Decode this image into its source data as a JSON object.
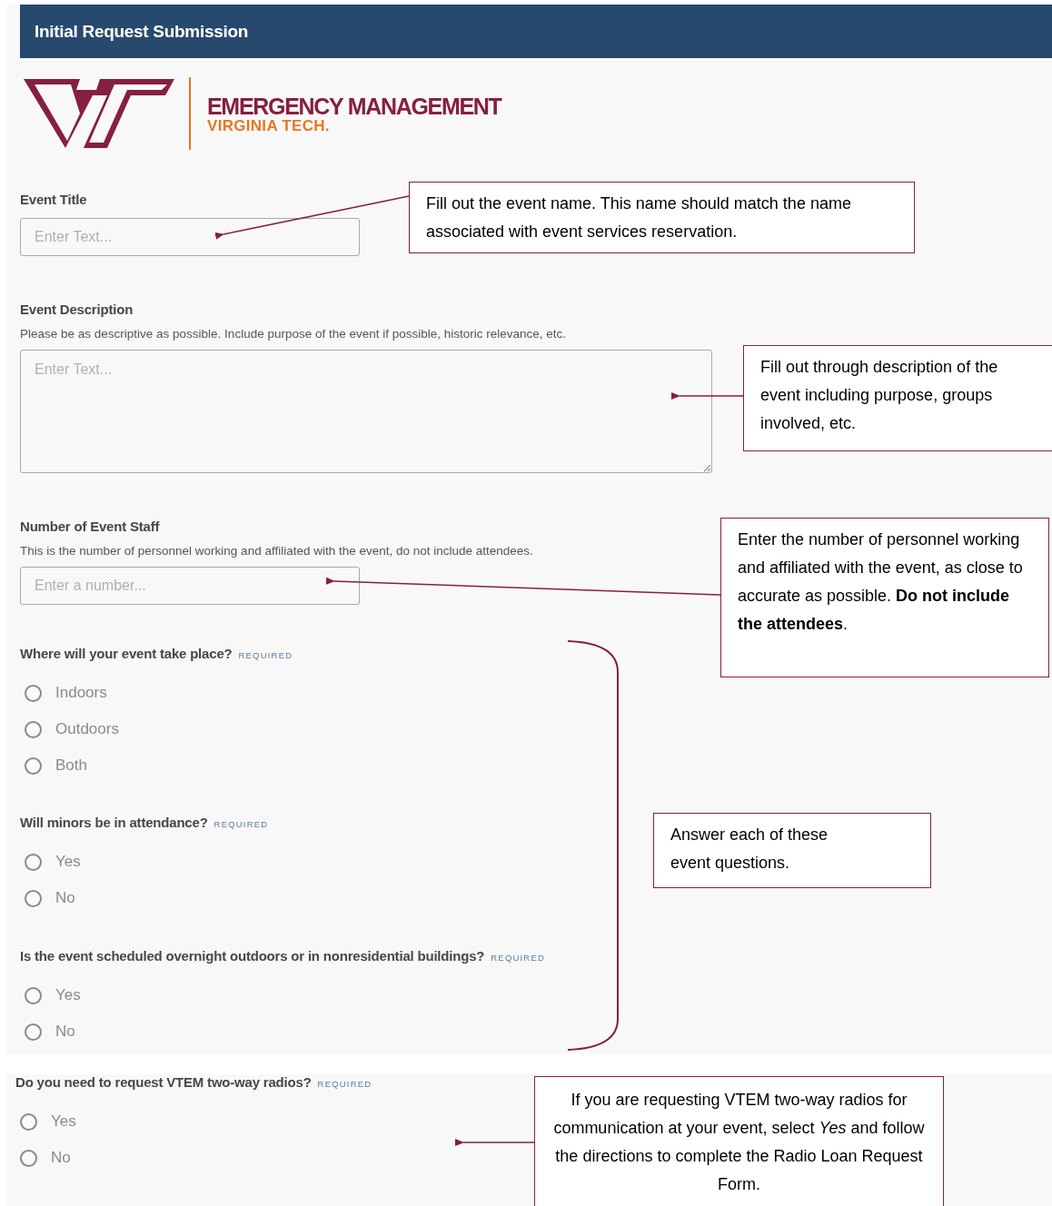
{
  "header": {
    "title": "Initial Request Submission"
  },
  "logo": {
    "title": "EMERGENCY MANAGEMENT",
    "subtitle": "VIRGINIA TECH."
  },
  "form": {
    "fields": [
      {
        "kind": "text",
        "label": "Event Title",
        "placeholder": "Enter Text..."
      },
      {
        "kind": "textarea",
        "label": "Event Description",
        "help": "Please be as descriptive as possible. Include purpose of the event if possible, historic relevance, etc.",
        "placeholder": "Enter Text..."
      },
      {
        "kind": "number",
        "label": "Number of Event Staff",
        "help": "This is the number of personnel working and affiliated with the event, do not include attendees.",
        "placeholder": "Enter a number..."
      }
    ],
    "questions": [
      {
        "label": "Where will your event take place?",
        "badge": "REQUIRED",
        "options": [
          {
            "label": "Indoors",
            "selected": false
          },
          {
            "label": "Outdoors",
            "selected": false
          },
          {
            "label": "Both",
            "selected": false
          }
        ]
      },
      {
        "label": "Will minors be in attendance?",
        "badge": "REQUIRED",
        "options": [
          {
            "label": "Yes",
            "selected": false
          },
          {
            "label": "No",
            "selected": false
          }
        ]
      },
      {
        "label": "Is the event scheduled overnight outdoors or in nonresidential buildings?",
        "badge": "REQUIRED",
        "options": [
          {
            "label": "Yes",
            "selected": false
          },
          {
            "label": "No",
            "selected": false
          }
        ]
      }
    ]
  },
  "radio_panel": {
    "questions": [
      {
        "label": "Do you need to request VTEM two-way radios?",
        "badge": "REQUIRED",
        "options": [
          {
            "label": "Yes",
            "selected": false
          },
          {
            "label": "No",
            "selected": false
          }
        ]
      }
    ]
  },
  "callouts": [
    {
      "text": "Fill out the event name. This name should match the name associated with event services reservation."
    },
    {
      "text": "Fill out through description of the event including purpose, groups involved, etc."
    },
    {
      "text": "Enter the number of personnel working and affiliated with the event, as close to accurate as possible. **Do not include the attendees**."
    },
    {
      "text": "Answer each of these event questions."
    },
    {
      "text": "If you are requesting VTEM two-way radios for communication at your event, select *Yes* and follow the directions to complete the Radio Loan Request Form."
    }
  ]
}
